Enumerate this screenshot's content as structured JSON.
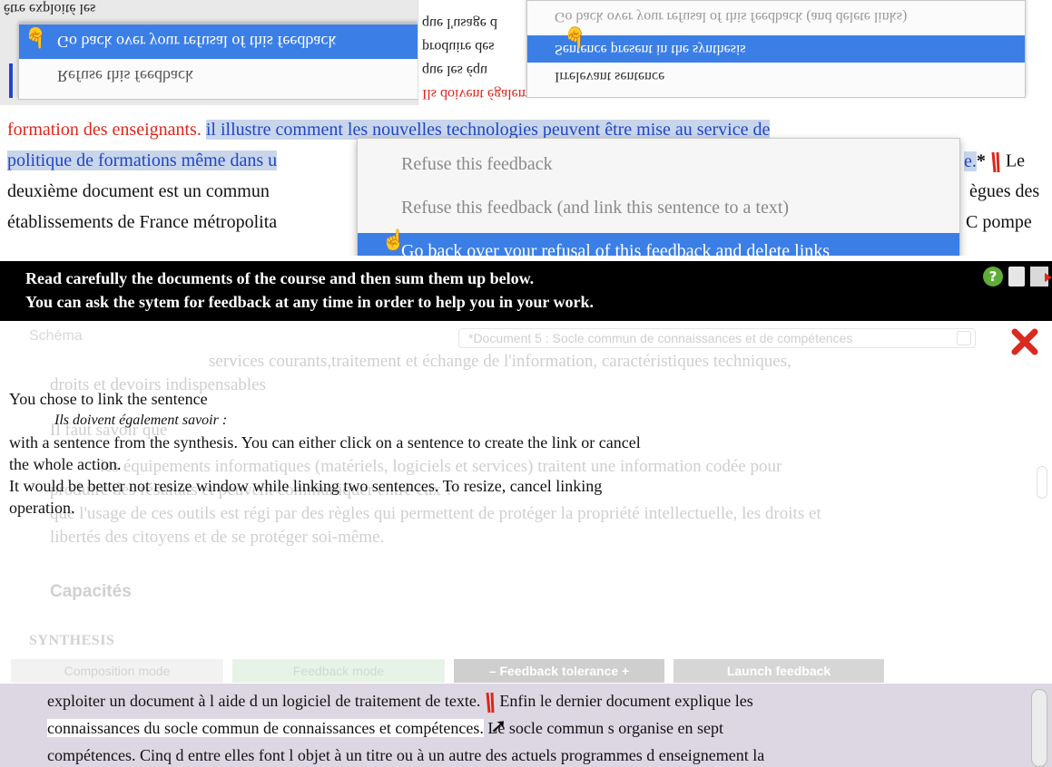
{
  "panel1": {
    "left_bg_text": "être exploité les",
    "menu_a": {
      "items": [
        "Refuse this feedback",
        "Go back over your refusal of this feedback"
      ]
    },
    "middle_lines": [
      "que l'usage d",
      "produire des",
      "que les équ",
      "Ils doivent également savoir :"
    ],
    "menu_b": {
      "items": [
        "Go back over your refusal of this feedback (and delete links)",
        "Sentence present in the synthesis",
        "Irrelevant sentence"
      ]
    }
  },
  "panel2": {
    "line1_red": "formation des enseignants.",
    "line1_blue": "il illustre comment les nouvelles technologies peuvent être mise au service de",
    "line2_blue": "politique de formations même dans u",
    "line2_blue_end": "e.",
    "line2_star": "*",
    "line2_end": "Le",
    "line3_left": "deuxième document est un commun",
    "line3_right": "ègues des",
    "line4_left": "établissements de France métropolita",
    "line4_right": "C pompe",
    "menu": {
      "items": [
        "Refuse this feedback",
        "Refuse this feedback (and link this sentence to a text)",
        "Go back over your refusal of this feedback and delete links"
      ]
    }
  },
  "panel3": {
    "header": {
      "line1": "Read carefully the documents of the course and then sum them up below.",
      "line2": "You can ask the sytem for feedback at any time in order to help you in your work.",
      "icons": [
        "help-icon",
        "book-icon",
        "exit-icon"
      ]
    },
    "section_label": "Schéma",
    "doc_select": "*Document 5 : Socle commun de connaissances et de compétences",
    "faded_lines": [
      "services courants,traitement et échange de l'information, caractéristiques techniques,",
      "droits et devoirs indispensables",
      "Il faut savoir que",
      "les équipements informatiques (matériels, logiciels et services) traitent une information codée pour",
      "produire des résultats et peuvent communiquer entre eux ?",
      "que l'usage de ces outils est régi par des règles qui permettent de protéger la propriété intellectuelle, les droits et",
      "libertés des citoyens et de se protéger soi-même."
    ],
    "capacites": "Capacités",
    "dialog": {
      "line1": "You chose to link the sentence",
      "quote": "Ils doivent également savoir :",
      "line3": "with a sentence from the synthesis. You can either click on a sentence to create the link or cancel",
      "line4": "the whole action.",
      "line5": "It would be better not resize window while linking two sentences. To resize, cancel linking",
      "line6": "operation."
    },
    "synthesis_title": "SYNTHESIS",
    "toolbar": {
      "compose": "Composition mode",
      "feedback": "Feedback mode",
      "tolerance": "–  Feedback tolerance  +",
      "launch": "Launch feedback"
    },
    "synthesis_lines": {
      "l1a": "exploiter un document à l aide d un logiciel de traitement de texte.",
      "l1b": "Enfin le dernier document explique les",
      "l2a": "connaissances du socle commun de connaissances et compétences.",
      "l2b": "Le socle commun s organise en sept",
      "l3": "compétences. Cinq d entre elles font l objet à un titre ou à un autre des actuels programmes d enseignement la"
    }
  }
}
